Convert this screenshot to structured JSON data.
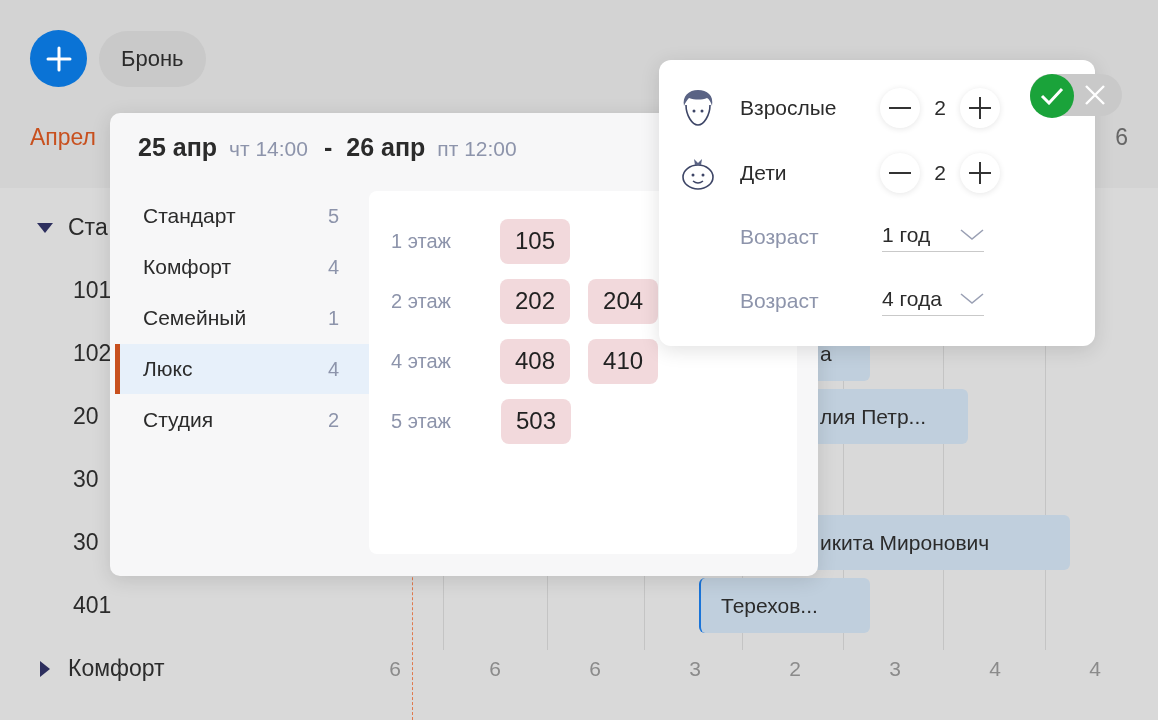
{
  "toolbar": {
    "booking_button": "Бронь"
  },
  "header": {
    "month": "Апрел",
    "day": "6"
  },
  "rows": [
    {
      "kind": "group",
      "label": "Ста",
      "expanded": true
    },
    {
      "kind": "room",
      "label": "101"
    },
    {
      "kind": "room",
      "label": "102",
      "booking": {
        "guest": "а",
        "selected": false
      }
    },
    {
      "kind": "room",
      "label": "20",
      "booking": {
        "guest": "лия Петр...",
        "selected": false
      }
    },
    {
      "kind": "room",
      "label": "30"
    },
    {
      "kind": "room",
      "label": "30",
      "booking": {
        "guest": "икита Миронович",
        "selected": false
      }
    },
    {
      "kind": "room",
      "label": "401",
      "booking": {
        "guest": "Терехов...",
        "selected": true
      }
    },
    {
      "kind": "group",
      "label": "Комфорт",
      "expanded": false,
      "counts": [
        "6",
        "6",
        "6",
        "3",
        "2",
        "3",
        "4",
        "4"
      ]
    }
  ],
  "date_popup": {
    "start_date": "25 апр",
    "start_time": "чт 14:00",
    "separator": "-",
    "end_date": "26 апр",
    "end_time": "пт 12:00",
    "categories": [
      {
        "name": "Стандарт",
        "count": "5",
        "selected": false
      },
      {
        "name": "Комфорт",
        "count": "4",
        "selected": false
      },
      {
        "name": "Семейный",
        "count": "1",
        "selected": false
      },
      {
        "name": "Люкс",
        "count": "4",
        "selected": true
      },
      {
        "name": "Студия",
        "count": "2",
        "selected": false
      }
    ],
    "floors": [
      {
        "label": "1 этаж",
        "rooms": [
          "105"
        ]
      },
      {
        "label": "2 этаж",
        "rooms": [
          "202",
          "204"
        ]
      },
      {
        "label": "4 этаж",
        "rooms": [
          "408",
          "410"
        ]
      },
      {
        "label": "5 этаж",
        "rooms": [
          "503"
        ]
      }
    ]
  },
  "guests_popup": {
    "counters": [
      {
        "kind": "adult",
        "label": "Взрослые",
        "value": "2"
      },
      {
        "kind": "child",
        "label": "Дети",
        "value": "2"
      }
    ],
    "ages": [
      {
        "label": "Возраст",
        "value": "1 год"
      },
      {
        "label": "Возраст",
        "value": "4 года"
      }
    ]
  }
}
